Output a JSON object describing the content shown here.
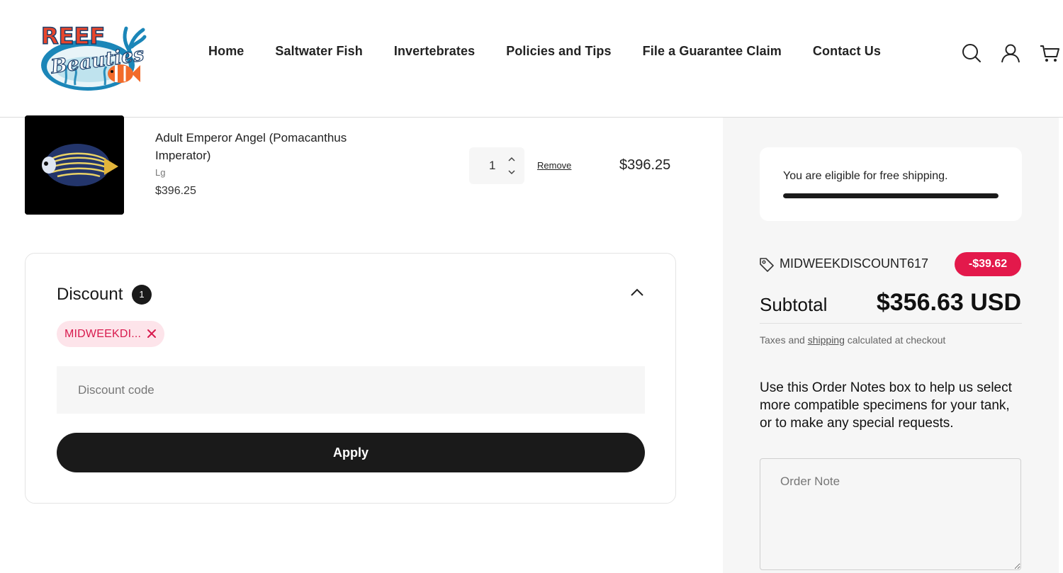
{
  "brand": {
    "logo_top": "REEF",
    "logo_bottom": "Beauties"
  },
  "nav": {
    "items": [
      {
        "label": "Home"
      },
      {
        "label": "Saltwater Fish"
      },
      {
        "label": "Invertebrates"
      },
      {
        "label": "Policies and Tips"
      },
      {
        "label": "File a Guarantee Claim"
      },
      {
        "label": "Contact Us"
      }
    ]
  },
  "header_icons": [
    "search-icon",
    "account-icon",
    "cart-icon"
  ],
  "cart": {
    "item": {
      "title": "Adult Emperor Angel (Pomacanthus Imperator)",
      "variant": "Lg",
      "price": "$396.25",
      "quantity": "1",
      "remove_label": "Remove",
      "line_total": "$396.25"
    }
  },
  "discount": {
    "title": "Discount",
    "count": "1",
    "applied_tag": "MIDWEEKDI...",
    "input_placeholder": "Discount code",
    "apply_label": "Apply"
  },
  "summary": {
    "shipping_message": "You are eligible for free shipping.",
    "shipping_progress": 1.0,
    "discount_code": "MIDWEEKDISCOUNT617",
    "discount_amount": "-$39.62",
    "subtotal_label": "Subtotal",
    "subtotal_value": "$356.63 USD",
    "tax_prefix": "Taxes and ",
    "tax_link": "shipping",
    "tax_suffix": " calculated at checkout",
    "notes_label": "Use this Order Notes box to help us select more compatible specimens for your tank, or to make any special requests.",
    "notes_placeholder": "Order Note"
  },
  "colors": {
    "accent": "#e3194b",
    "pill_bg": "#fde4ea",
    "dark": "#1a1a1a",
    "panel_bg": "#f6f6f6"
  }
}
